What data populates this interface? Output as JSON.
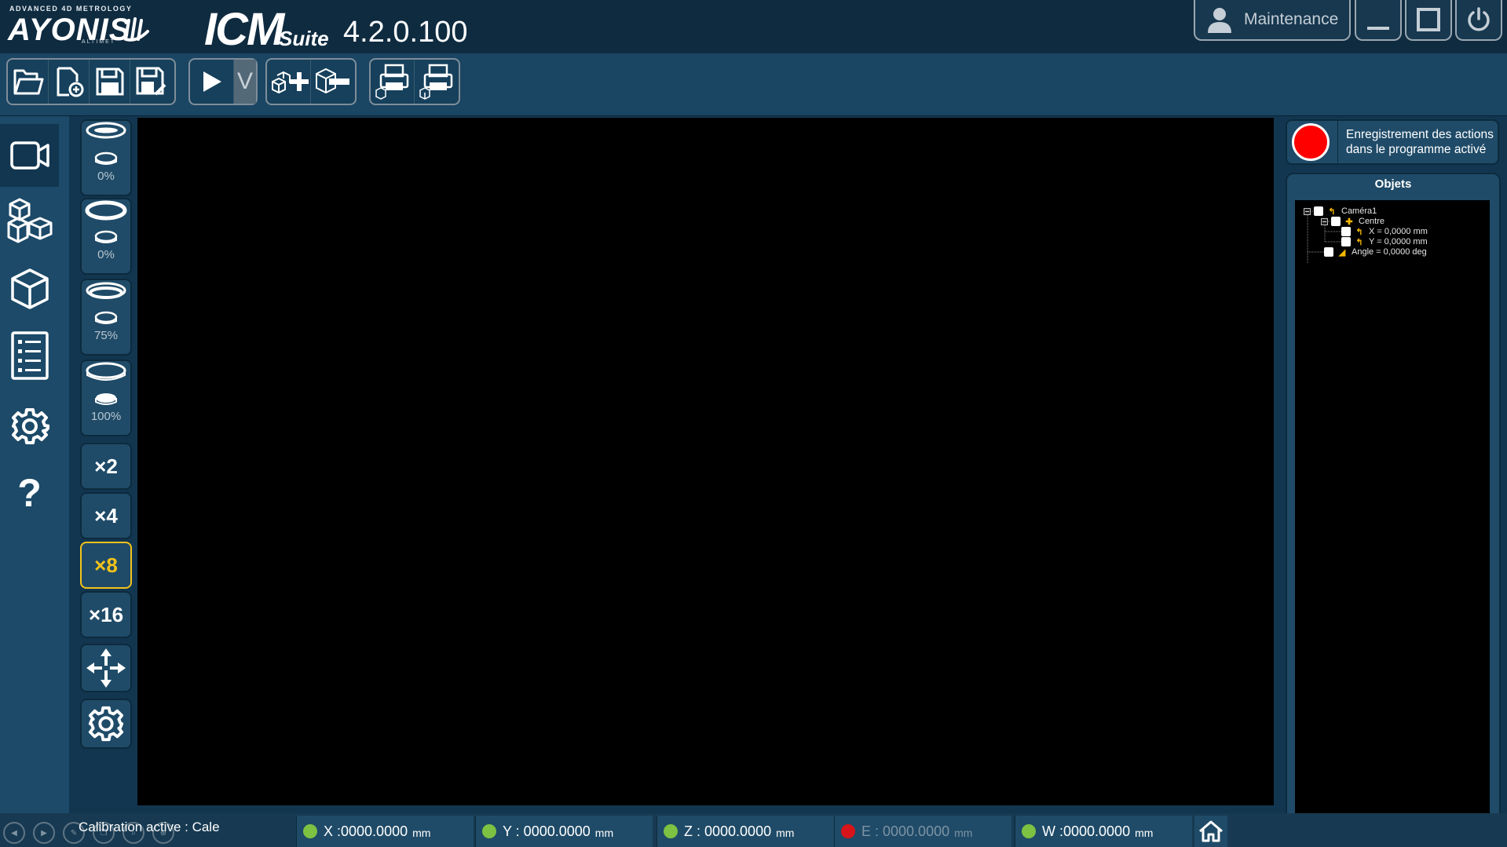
{
  "header": {
    "brand_tagline": "ADVANCED 4D METROLOGY",
    "brand_name": "AYONIS",
    "brand_sub": "ALTIMET",
    "product_name": "ICM",
    "product_suffix": "Suite",
    "version": "4.2.0.100",
    "user_label": "Maintenance"
  },
  "toolbar": {
    "icons": [
      "open-folder-icon",
      "new-file-icon",
      "save-icon",
      "save-as-icon",
      "play-icon",
      "dropdown-v-icon",
      "add-object-icon",
      "remove-object-icon",
      "print-icon",
      "print-report-icon"
    ],
    "run_dropdown_label": "V"
  },
  "left_rail": {
    "items": [
      "camera-icon",
      "cubes-icon",
      "cube-icon",
      "list-icon",
      "settings-icon",
      "help-icon"
    ],
    "help_glyph": "?"
  },
  "lights": [
    {
      "name": "coaxial",
      "percent": "0%"
    },
    {
      "name": "ring",
      "percent": "0%"
    },
    {
      "name": "segment",
      "percent": "75%"
    },
    {
      "name": "backlight",
      "percent": "100%"
    }
  ],
  "zoom": {
    "options": [
      "×2",
      "×4",
      "×8",
      "×16"
    ],
    "selected": "×8"
  },
  "recording": {
    "text_line1": "Enregistrement des actions",
    "text_line2": "dans le programme activé",
    "color": "#ff0000"
  },
  "objects": {
    "title": "Objets",
    "tree": [
      {
        "label": "Caméra1"
      },
      {
        "label": "Centre"
      },
      {
        "label": "X = 0,0000 mm"
      },
      {
        "label": "Y = 0,0000 mm"
      },
      {
        "label": "Angle = 0,0000 deg"
      }
    ]
  },
  "status": {
    "calibration": "Calibration active : Cale",
    "coords": [
      {
        "axis": "X :0000.0000",
        "unit": "mm",
        "color": "#7dc242",
        "enabled": true
      },
      {
        "axis": "Y : 0000.0000",
        "unit": "mm",
        "color": "#7dc242",
        "enabled": true
      },
      {
        "axis": "Z : 0000.0000",
        "unit": "mm",
        "color": "#7dc242",
        "enabled": true
      },
      {
        "axis": "E : 0000.0000",
        "unit": "mm",
        "color": "#d7141a",
        "enabled": false
      },
      {
        "axis": "W :0000.0000",
        "unit": "mm",
        "color": "#7dc242",
        "enabled": true
      }
    ]
  },
  "colors": {
    "accent": "#f3c21b",
    "background": "#123650",
    "panel": "#1f4b68"
  }
}
